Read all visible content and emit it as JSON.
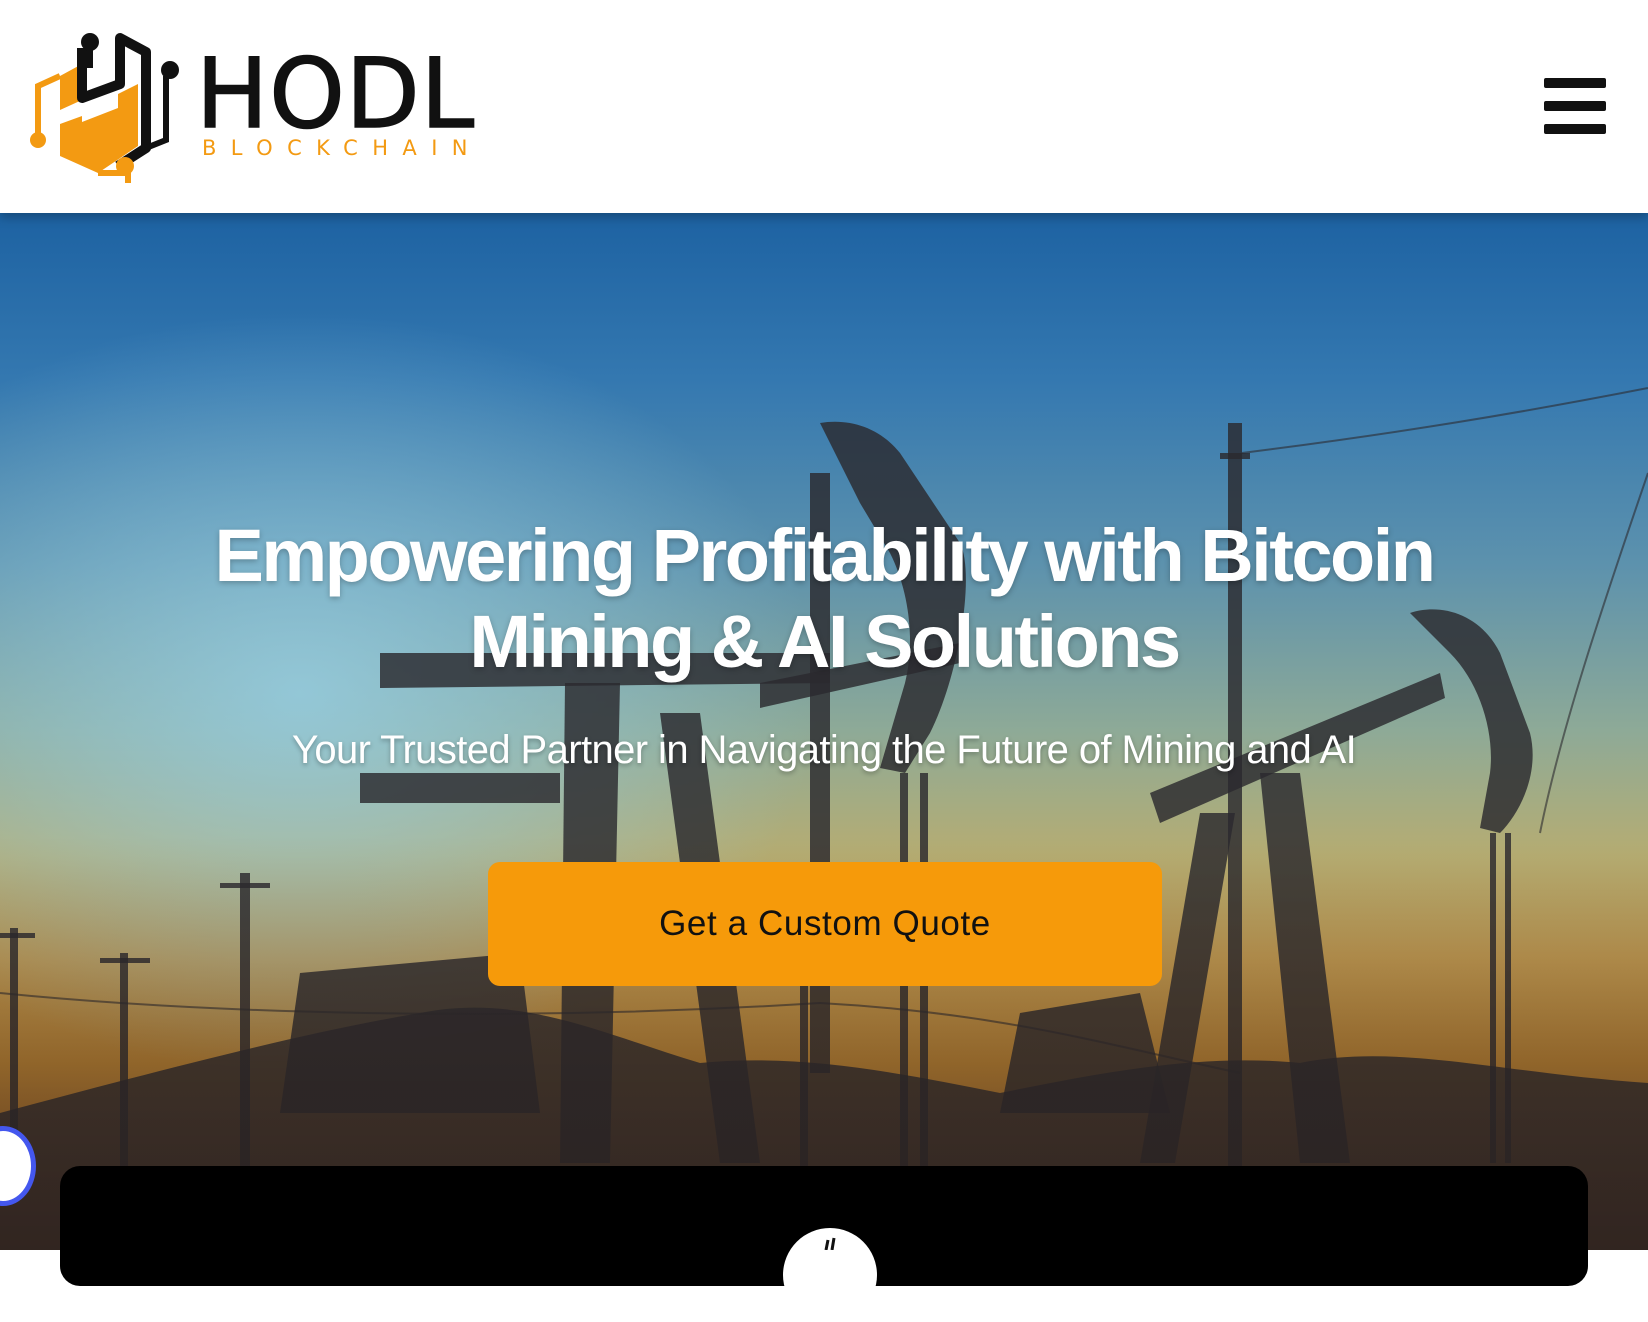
{
  "header": {
    "logo": {
      "wordmark": "HODL",
      "subtitle": "BLOCKCHAIN",
      "colors": {
        "primary": "#111111",
        "accent": "#f39a12"
      }
    },
    "menu_icon": "hamburger-menu-icon"
  },
  "hero": {
    "title_line1": "Empowering Profitability with Bitcoin",
    "title_line2": "Mining & AI Solutions",
    "subtitle": "Your Trusted Partner in Navigating the Future of Mining and AI",
    "cta_label": "Get a Custom Quote",
    "cta_color": "#f69a0a",
    "background": "oil pumpjacks at sunset"
  },
  "stats_card": {
    "icon": "card-badge-icon"
  },
  "chat_widget": {
    "icon": "chat-widget-icon",
    "accent": "#4457ee"
  }
}
